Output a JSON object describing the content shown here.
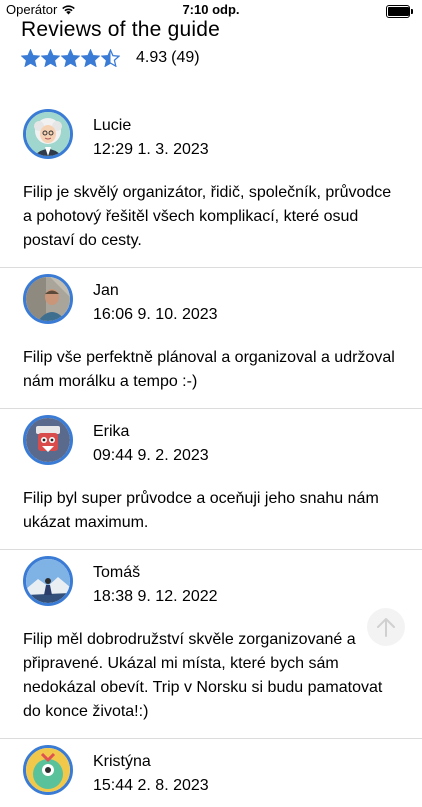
{
  "status": {
    "carrier": "Operátor",
    "time": "7:10 odp.",
    "battery_level": 0.95
  },
  "page": {
    "title": "Reviews of the guide"
  },
  "summary": {
    "stars": 4.5,
    "score": "4.93",
    "count": "(49)",
    "star_color": "#3a7bd5"
  },
  "reviews": [
    {
      "name": "Lucie",
      "time": "12:29",
      "date": "1. 3. 2023",
      "avatar": "lucie-avatar",
      "text": "Filip je skvělý organizátor, řidič, společník, průvodce a pohotový řešitěl všech komplikací, které osud postaví do cesty."
    },
    {
      "name": "Jan",
      "time": "16:06",
      "date": "9. 10. 2023",
      "avatar": "jan-avatar",
      "text": "Filip vše perfektně plánoval a organizoval a udržoval nám morálku a tempo :-)"
    },
    {
      "name": "Erika",
      "time": "09:44",
      "date": "9. 2. 2023",
      "avatar": "erika-avatar",
      "text": "Filip byl super průvodce a oceňuji jeho snahu nám ukázat maximum."
    },
    {
      "name": "Tomáš",
      "time": "18:38",
      "date": "9. 12. 2022",
      "avatar": "tomas-avatar",
      "text": "Filip měl dobrodružství skvěle zorganizované a připravené. Ukázal mi místa, které bych sám nedokázal obevít. Trip v Norsku si budu pamatovat do konce života!:)"
    },
    {
      "name": "Kristýna",
      "time": "15:44",
      "date": "2. 8. 2023",
      "avatar": "kristyna-avatar",
      "text": ""
    }
  ],
  "accent_color": "#3a7bd5"
}
